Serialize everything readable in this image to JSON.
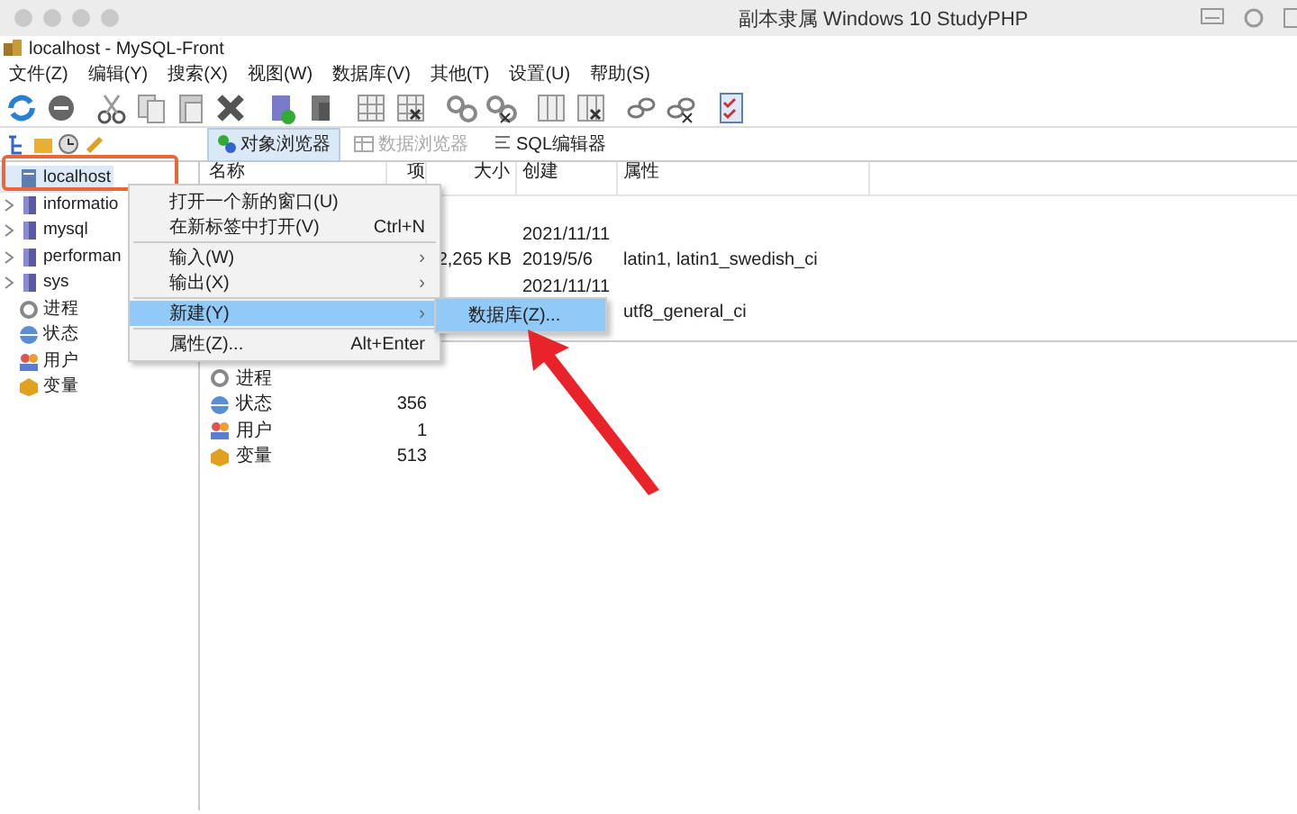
{
  "host_window": {
    "title": "副本隶属 Windows 10 StudyPHP"
  },
  "window": {
    "title": "localhost - MySQL-Front"
  },
  "menu": [
    "文件(Z)",
    "编辑(Y)",
    "搜索(X)",
    "视图(W)",
    "数据库(V)",
    "其他(T)",
    "设置(U)",
    "帮助(S)"
  ],
  "view_tabs": [
    {
      "label": "对象浏览器",
      "selected": true,
      "disabled": false
    },
    {
      "label": "数据浏览器",
      "selected": false,
      "disabled": true
    },
    {
      "label": "SQL编辑器",
      "selected": false,
      "disabled": false
    }
  ],
  "tree": [
    {
      "label": "localhost",
      "kind": "server",
      "selected": true,
      "expander": false
    },
    {
      "label": "informatio",
      "kind": "database",
      "selected": false,
      "expander": true
    },
    {
      "label": "mysql",
      "kind": "database",
      "selected": false,
      "expander": true
    },
    {
      "label": "performan",
      "kind": "database",
      "selected": false,
      "expander": true
    },
    {
      "label": "sys",
      "kind": "database",
      "selected": false,
      "expander": true
    },
    {
      "label": "进程",
      "kind": "process",
      "selected": false,
      "expander": false
    },
    {
      "label": "状态",
      "kind": "status",
      "selected": false,
      "expander": false
    },
    {
      "label": "用户",
      "kind": "users",
      "selected": false,
      "expander": false
    },
    {
      "label": "变量",
      "kind": "variables",
      "selected": false,
      "expander": false
    }
  ],
  "table": {
    "columns": [
      "名称",
      "项",
      "大小",
      "创建",
      "属性"
    ],
    "groups": [
      [
        {
          "created": "2021/11/11"
        },
        {
          "size": "2,265 KB",
          "created": "2019/5/6",
          "attributes": "latin1, latin1_swedish_ci"
        },
        {
          "created": "2021/11/11"
        },
        {
          "attributes": "utf8_general_ci"
        }
      ],
      [
        {
          "name": "进程",
          "kind": "process"
        },
        {
          "name": "状态",
          "kind": "status",
          "items": "356"
        },
        {
          "name": "用户",
          "kind": "users",
          "items": "1"
        },
        {
          "name": "变量",
          "kind": "variables",
          "items": "513"
        }
      ]
    ]
  },
  "context_menu": [
    {
      "kind": "item",
      "label": "打开一个新的窗口(U)",
      "selected": false
    },
    {
      "kind": "item",
      "label": "在新标签中打开(V)",
      "shortcut": "Ctrl+N",
      "selected": false
    },
    {
      "kind": "separator"
    },
    {
      "kind": "item",
      "label": "输入(W)",
      "submenu": "›",
      "selected": false
    },
    {
      "kind": "item",
      "label": "输出(X)",
      "submenu": "›",
      "selected": false
    },
    {
      "kind": "separator"
    },
    {
      "kind": "item",
      "label": "新建(Y)",
      "submenu": "›",
      "selected": true
    },
    {
      "kind": "separator"
    },
    {
      "kind": "item",
      "label": "属性(Z)...",
      "shortcut": "Alt+Enter",
      "selected": false
    }
  ],
  "submenu": [
    {
      "label": "数据库(Z)...",
      "selected": true
    }
  ]
}
